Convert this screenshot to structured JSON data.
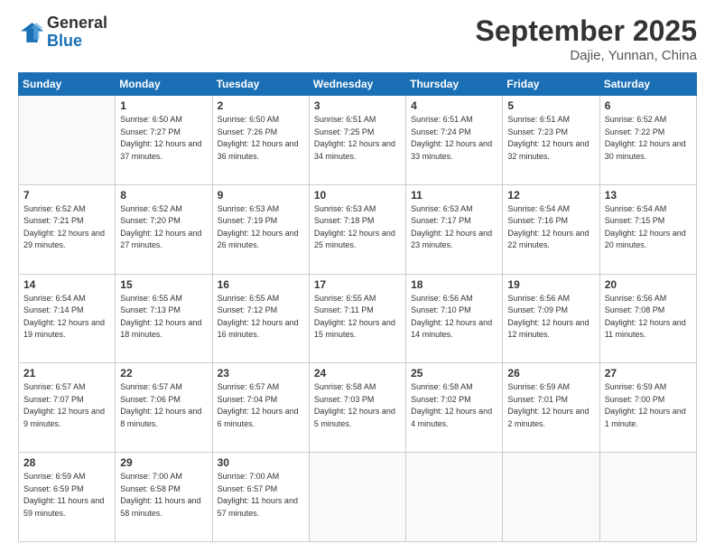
{
  "header": {
    "logo": {
      "general": "General",
      "blue": "Blue"
    },
    "title": "September 2025",
    "location": "Dajie, Yunnan, China"
  },
  "days_of_week": [
    "Sunday",
    "Monday",
    "Tuesday",
    "Wednesday",
    "Thursday",
    "Friday",
    "Saturday"
  ],
  "weeks": [
    [
      {
        "day": "",
        "sunrise": "",
        "sunset": "",
        "daylight": ""
      },
      {
        "day": "1",
        "sunrise": "Sunrise: 6:50 AM",
        "sunset": "Sunset: 7:27 PM",
        "daylight": "Daylight: 12 hours and 37 minutes."
      },
      {
        "day": "2",
        "sunrise": "Sunrise: 6:50 AM",
        "sunset": "Sunset: 7:26 PM",
        "daylight": "Daylight: 12 hours and 36 minutes."
      },
      {
        "day": "3",
        "sunrise": "Sunrise: 6:51 AM",
        "sunset": "Sunset: 7:25 PM",
        "daylight": "Daylight: 12 hours and 34 minutes."
      },
      {
        "day": "4",
        "sunrise": "Sunrise: 6:51 AM",
        "sunset": "Sunset: 7:24 PM",
        "daylight": "Daylight: 12 hours and 33 minutes."
      },
      {
        "day": "5",
        "sunrise": "Sunrise: 6:51 AM",
        "sunset": "Sunset: 7:23 PM",
        "daylight": "Daylight: 12 hours and 32 minutes."
      },
      {
        "day": "6",
        "sunrise": "Sunrise: 6:52 AM",
        "sunset": "Sunset: 7:22 PM",
        "daylight": "Daylight: 12 hours and 30 minutes."
      }
    ],
    [
      {
        "day": "7",
        "sunrise": "Sunrise: 6:52 AM",
        "sunset": "Sunset: 7:21 PM",
        "daylight": "Daylight: 12 hours and 29 minutes."
      },
      {
        "day": "8",
        "sunrise": "Sunrise: 6:52 AM",
        "sunset": "Sunset: 7:20 PM",
        "daylight": "Daylight: 12 hours and 27 minutes."
      },
      {
        "day": "9",
        "sunrise": "Sunrise: 6:53 AM",
        "sunset": "Sunset: 7:19 PM",
        "daylight": "Daylight: 12 hours and 26 minutes."
      },
      {
        "day": "10",
        "sunrise": "Sunrise: 6:53 AM",
        "sunset": "Sunset: 7:18 PM",
        "daylight": "Daylight: 12 hours and 25 minutes."
      },
      {
        "day": "11",
        "sunrise": "Sunrise: 6:53 AM",
        "sunset": "Sunset: 7:17 PM",
        "daylight": "Daylight: 12 hours and 23 minutes."
      },
      {
        "day": "12",
        "sunrise": "Sunrise: 6:54 AM",
        "sunset": "Sunset: 7:16 PM",
        "daylight": "Daylight: 12 hours and 22 minutes."
      },
      {
        "day": "13",
        "sunrise": "Sunrise: 6:54 AM",
        "sunset": "Sunset: 7:15 PM",
        "daylight": "Daylight: 12 hours and 20 minutes."
      }
    ],
    [
      {
        "day": "14",
        "sunrise": "Sunrise: 6:54 AM",
        "sunset": "Sunset: 7:14 PM",
        "daylight": "Daylight: 12 hours and 19 minutes."
      },
      {
        "day": "15",
        "sunrise": "Sunrise: 6:55 AM",
        "sunset": "Sunset: 7:13 PM",
        "daylight": "Daylight: 12 hours and 18 minutes."
      },
      {
        "day": "16",
        "sunrise": "Sunrise: 6:55 AM",
        "sunset": "Sunset: 7:12 PM",
        "daylight": "Daylight: 12 hours and 16 minutes."
      },
      {
        "day": "17",
        "sunrise": "Sunrise: 6:55 AM",
        "sunset": "Sunset: 7:11 PM",
        "daylight": "Daylight: 12 hours and 15 minutes."
      },
      {
        "day": "18",
        "sunrise": "Sunrise: 6:56 AM",
        "sunset": "Sunset: 7:10 PM",
        "daylight": "Daylight: 12 hours and 14 minutes."
      },
      {
        "day": "19",
        "sunrise": "Sunrise: 6:56 AM",
        "sunset": "Sunset: 7:09 PM",
        "daylight": "Daylight: 12 hours and 12 minutes."
      },
      {
        "day": "20",
        "sunrise": "Sunrise: 6:56 AM",
        "sunset": "Sunset: 7:08 PM",
        "daylight": "Daylight: 12 hours and 11 minutes."
      }
    ],
    [
      {
        "day": "21",
        "sunrise": "Sunrise: 6:57 AM",
        "sunset": "Sunset: 7:07 PM",
        "daylight": "Daylight: 12 hours and 9 minutes."
      },
      {
        "day": "22",
        "sunrise": "Sunrise: 6:57 AM",
        "sunset": "Sunset: 7:06 PM",
        "daylight": "Daylight: 12 hours and 8 minutes."
      },
      {
        "day": "23",
        "sunrise": "Sunrise: 6:57 AM",
        "sunset": "Sunset: 7:04 PM",
        "daylight": "Daylight: 12 hours and 6 minutes."
      },
      {
        "day": "24",
        "sunrise": "Sunrise: 6:58 AM",
        "sunset": "Sunset: 7:03 PM",
        "daylight": "Daylight: 12 hours and 5 minutes."
      },
      {
        "day": "25",
        "sunrise": "Sunrise: 6:58 AM",
        "sunset": "Sunset: 7:02 PM",
        "daylight": "Daylight: 12 hours and 4 minutes."
      },
      {
        "day": "26",
        "sunrise": "Sunrise: 6:59 AM",
        "sunset": "Sunset: 7:01 PM",
        "daylight": "Daylight: 12 hours and 2 minutes."
      },
      {
        "day": "27",
        "sunrise": "Sunrise: 6:59 AM",
        "sunset": "Sunset: 7:00 PM",
        "daylight": "Daylight: 12 hours and 1 minute."
      }
    ],
    [
      {
        "day": "28",
        "sunrise": "Sunrise: 6:59 AM",
        "sunset": "Sunset: 6:59 PM",
        "daylight": "Daylight: 11 hours and 59 minutes."
      },
      {
        "day": "29",
        "sunrise": "Sunrise: 7:00 AM",
        "sunset": "Sunset: 6:58 PM",
        "daylight": "Daylight: 11 hours and 58 minutes."
      },
      {
        "day": "30",
        "sunrise": "Sunrise: 7:00 AM",
        "sunset": "Sunset: 6:57 PM",
        "daylight": "Daylight: 11 hours and 57 minutes."
      },
      {
        "day": "",
        "sunrise": "",
        "sunset": "",
        "daylight": ""
      },
      {
        "day": "",
        "sunrise": "",
        "sunset": "",
        "daylight": ""
      },
      {
        "day": "",
        "sunrise": "",
        "sunset": "",
        "daylight": ""
      },
      {
        "day": "",
        "sunrise": "",
        "sunset": "",
        "daylight": ""
      }
    ]
  ]
}
